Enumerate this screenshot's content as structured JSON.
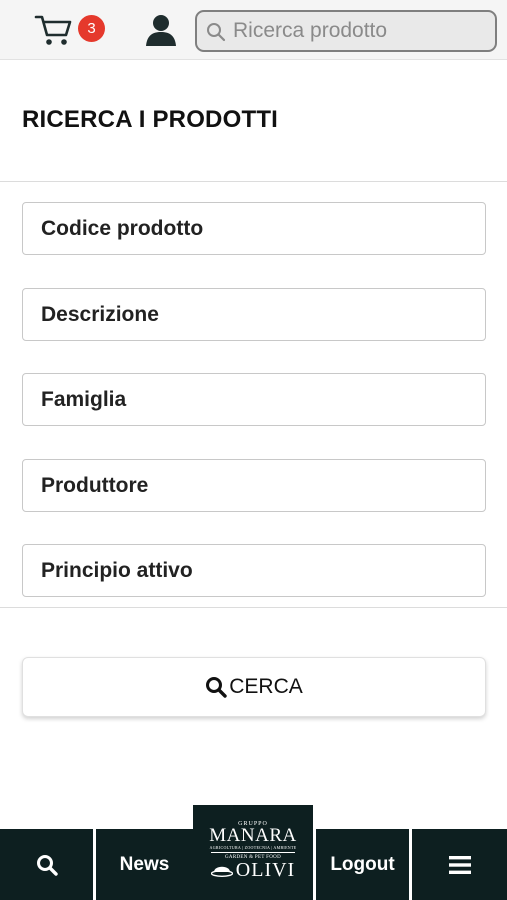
{
  "header": {
    "cart_count": "3",
    "search_placeholder": "Ricerca prodotto"
  },
  "page": {
    "title": "RICERCA I PRODOTTI"
  },
  "fields": [
    {
      "label": "Codice prodotto"
    },
    {
      "label": "Descrizione"
    },
    {
      "label": "Famiglia"
    },
    {
      "label": "Produttore"
    },
    {
      "label": "Principio attivo"
    }
  ],
  "search_button": {
    "label": "CERCA"
  },
  "bottom_nav": {
    "news": "News",
    "logout": "Logout",
    "logo": {
      "gruppo": "GRUPPO",
      "manara": "MANARA",
      "manara_tagline": "AGRICOLTURA | ZOOTECNIA | AMBIENTE",
      "olivi_tagline": "GARDEN & PET FOOD",
      "olivi": "OLIVI"
    }
  },
  "colors": {
    "badge": "#e5392c",
    "nav_background": "#0d1f20"
  },
  "icons": {
    "cart": "cart-icon",
    "user": "user-icon",
    "search": "search-icon",
    "menu": "menu-icon"
  }
}
